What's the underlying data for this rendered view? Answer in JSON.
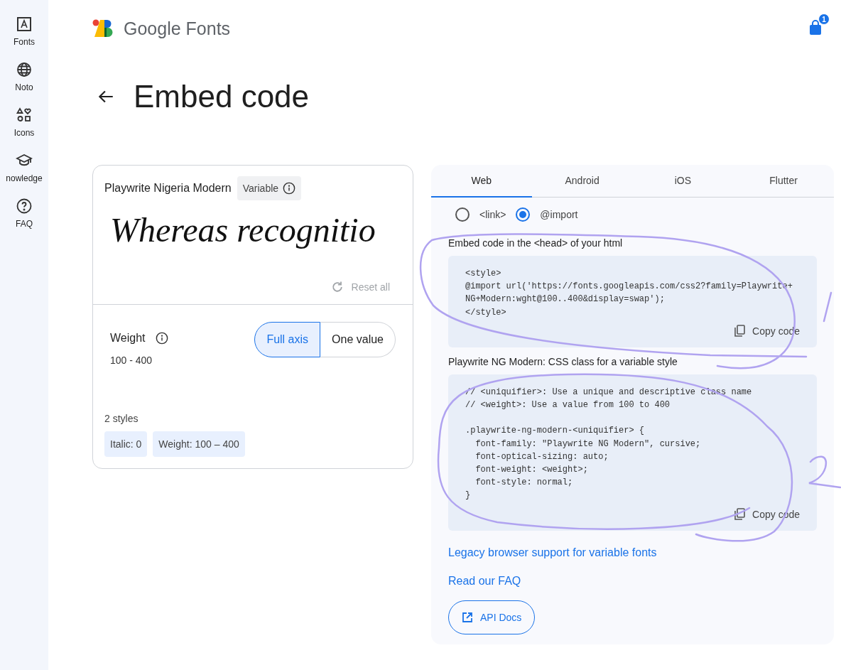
{
  "sidebar": {
    "items": [
      {
        "label": "Fonts"
      },
      {
        "label": "Noto"
      },
      {
        "label": "Icons"
      },
      {
        "label": "nowledge"
      },
      {
        "label": "FAQ"
      }
    ]
  },
  "header": {
    "logo_text": "Google Fonts",
    "cart_badge": "1"
  },
  "page_title": "Embed code",
  "font_card": {
    "name": "Playwrite Nigeria Modern",
    "tag": "Variable",
    "sample": "Whereas recognitio",
    "reset": "Reset all",
    "axis": {
      "label": "Weight",
      "range": "100 - 400",
      "options": [
        {
          "label": "Full axis",
          "selected": true
        },
        {
          "label": "One value",
          "selected": false
        }
      ]
    },
    "styles_label": "2 styles",
    "chips": [
      "Italic: 0",
      "Weight: 100 – 400"
    ]
  },
  "embed": {
    "tabs": [
      {
        "label": "Web",
        "selected": true
      },
      {
        "label": "Android",
        "selected": false
      },
      {
        "label": "iOS",
        "selected": false
      },
      {
        "label": "Flutter",
        "selected": false
      }
    ],
    "methods": [
      {
        "label": "<link>",
        "selected": false
      },
      {
        "label": "@import",
        "selected": true
      }
    ],
    "sections": [
      {
        "heading": "Embed code in the <head> of your html",
        "code": "<style>\n@import url('https://fonts.googleapis.com/css2?family=Playwrite+\nNG+Modern:wght@100..400&display=swap');\n</style>",
        "copy": "Copy code"
      },
      {
        "heading": "Playwrite NG Modern: CSS class for a variable style",
        "code": "// <uniquifier>: Use a unique and descriptive class name\n// <weight>: Use a value from 100 to 400\n\n.playwrite-ng-modern-<uniquifier> {\n  font-family: \"Playwrite NG Modern\", cursive;\n  font-optical-sizing: auto;\n  font-weight: <weight>;\n  font-style: normal;\n}",
        "copy": "Copy code"
      }
    ],
    "links": [
      "Legacy browser support for variable fonts",
      "Read our FAQ"
    ],
    "api_button": "API Docs"
  }
}
